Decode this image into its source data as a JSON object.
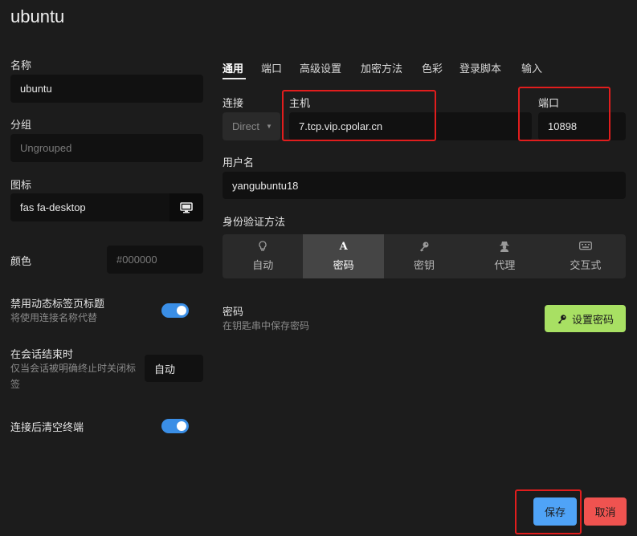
{
  "window": {
    "title": "ubuntu"
  },
  "left": {
    "name_label": "名称",
    "name_value": "ubuntu",
    "group_label": "分组",
    "group_placeholder": "Ungrouped",
    "icon_label": "图标",
    "icon_value": "fas fa-desktop",
    "color_label": "颜色",
    "color_placeholder": "#000000",
    "disable_dynamic_title_label": "禁用动态标签页标题",
    "disable_dynamic_title_desc": "将使用连接名称代替",
    "disable_dynamic_title_on": true,
    "session_end_label": "在会话结束时",
    "session_end_desc": "仅当会话被明确终止时关闭标签",
    "session_end_value": "自动",
    "clear_terminal_label": "连接后清空终端",
    "clear_terminal_on": true
  },
  "tabs": [
    "通用",
    "端口",
    "高级设置",
    "加密方法",
    "色彩",
    "登录脚本",
    "输入"
  ],
  "active_tab": "通用",
  "general": {
    "connection_label": "连接",
    "connection_value": "Direct",
    "host_label": "主机",
    "host_value": "7.tcp.vip.cpolar.cn",
    "port_label": "端口",
    "port_value": "10898",
    "username_label": "用户名",
    "username_value": "yangubuntu18",
    "auth_label": "身份验证方法",
    "auth_methods": [
      {
        "label": "自动",
        "icon": "lightbulb-icon"
      },
      {
        "label": "密码",
        "icon": "font-a-icon"
      },
      {
        "label": "密钥",
        "icon": "key-icon"
      },
      {
        "label": "代理",
        "icon": "user-secret-icon"
      },
      {
        "label": "交互式",
        "icon": "keyboard-icon"
      }
    ],
    "active_auth": "密码",
    "password_label": "密码",
    "password_desc": "在钥匙串中保存密码",
    "set_password_button": "设置密码"
  },
  "footer": {
    "save_button": "保存",
    "cancel_button": "取消"
  },
  "colors": {
    "accent": "#3a8ee6",
    "save_bg": "#4fa3f7",
    "cancel_bg": "#ef5350",
    "set_password_bg": "#a8e063",
    "highlight": "#e11d1d"
  }
}
